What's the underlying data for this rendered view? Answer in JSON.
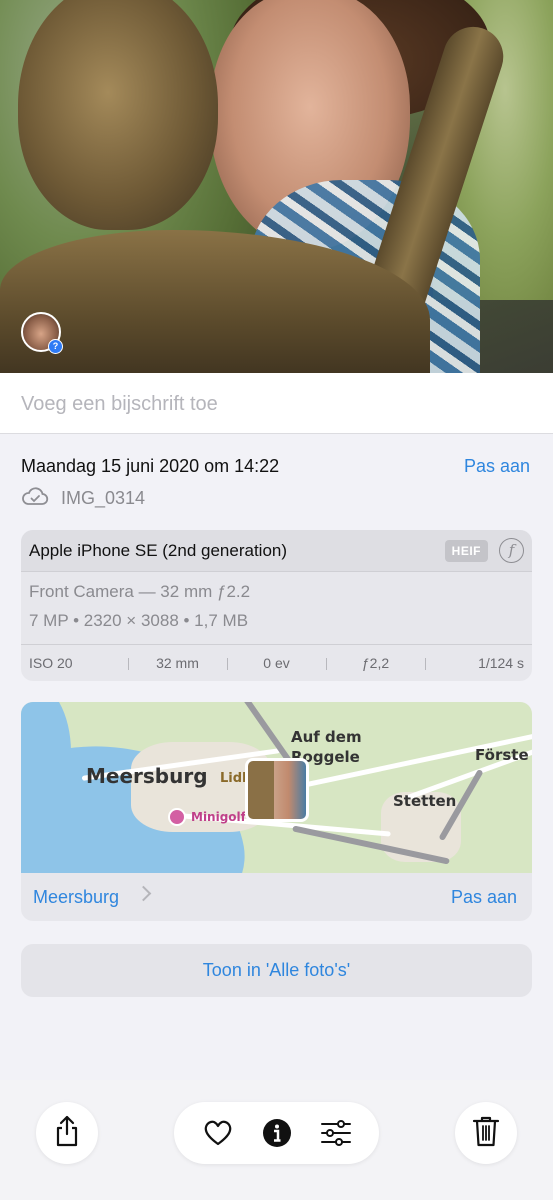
{
  "caption": {
    "placeholder": "Voeg een bijschrift toe"
  },
  "photo": {
    "faces_badge": "?"
  },
  "metadata": {
    "date": "Maandag 15 juni 2020 om 14:22",
    "edit_label": "Pas aan",
    "filename": "IMG_0314"
  },
  "camera": {
    "model": "Apple iPhone SE (2nd generation)",
    "format_badge": "HEIF",
    "lens": "Front Camera — 32 mm ƒ2.2",
    "resolution": "7 MP • 2320 × 3088 • 1,7 MB",
    "exif": {
      "iso": "ISO 20",
      "focal": "32 mm",
      "ev": "0 ev",
      "aperture": "ƒ2,2",
      "shutter": "1/124 s"
    }
  },
  "map": {
    "labels": {
      "meersburg": "Meersburg",
      "lidl": "Lidl",
      "auf_dem": "Auf dem",
      "roggele": "Roggele",
      "forste": "Förste",
      "stetten": "Stetten",
      "minigolf": "Minigolf"
    },
    "place": "Meersburg",
    "edit_label": "Pas aan"
  },
  "show_all_label": "Toon in 'Alle foto's'",
  "toolbar": {
    "share": "share-icon",
    "favorite": "heart-icon",
    "info": "info-icon",
    "adjust": "sliders-icon",
    "delete": "trash-icon"
  },
  "colors": {
    "accent": "#2f86de",
    "background": "#f2f2f7"
  }
}
